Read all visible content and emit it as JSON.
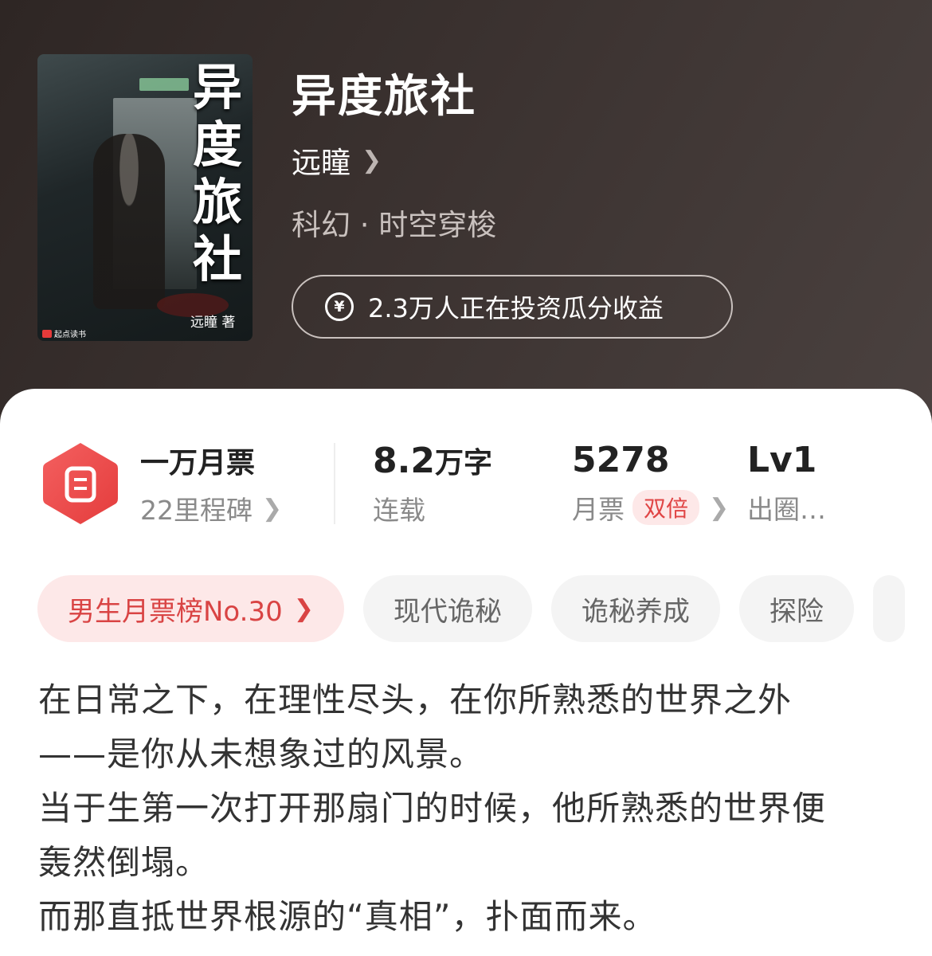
{
  "book": {
    "title": "异度旅社",
    "author": "远瞳",
    "genre": "科幻 · 时空穿梭",
    "invest_text": "2.3万人正在投资瓜分收益",
    "cover": {
      "title_vertical": "异度旅社",
      "author_mark": "远瞳 著",
      "publisher": "起点读书"
    }
  },
  "stats": {
    "badge": {
      "title": "一万月票",
      "sub": "22里程碑"
    },
    "words": {
      "value": "8.2",
      "unit": "万字",
      "sub": "连载"
    },
    "tickets": {
      "value": "5278",
      "sub": "月票",
      "tag": "双倍"
    },
    "level": {
      "value": "Lv1",
      "sub": "出圈…"
    }
  },
  "tags": [
    {
      "label": "男生月票榜No.30"
    },
    {
      "label": "现代诡秘"
    },
    {
      "label": "诡秘养成"
    },
    {
      "label": "探险"
    }
  ],
  "description": [
    "在日常之下，在理性尽头，在你所熟悉的世界之外",
    "——是你从未想象过的风景。",
    "当于生第一次打开那扇门的时候，他所熟悉的世界便",
    "轰然倒塌。",
    "而那直抵世界根源的“真相”，扑面而来。"
  ],
  "colors": {
    "accent": "#e04545",
    "badge": "#ee4b4b",
    "hero_bg": "#3b3230"
  }
}
